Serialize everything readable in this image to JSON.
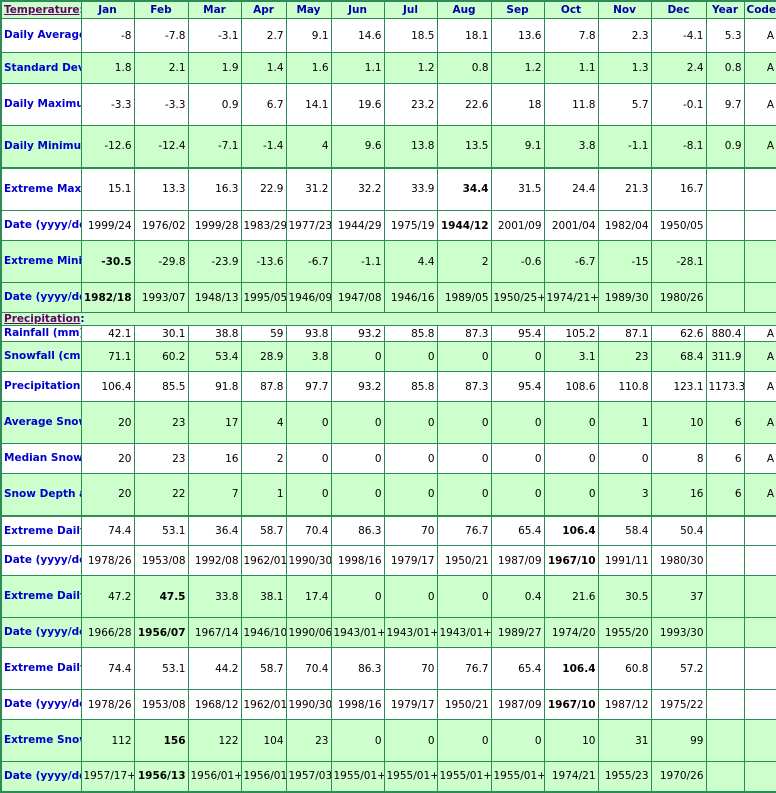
{
  "header": {
    "section_label": "Temperature",
    "months": [
      "Jan",
      "Feb",
      "Mar",
      "Apr",
      "May",
      "Jun",
      "Jul",
      "Aug",
      "Sep",
      "Oct",
      "Nov",
      "Dec"
    ],
    "year_label": "Year",
    "code_label": "Code"
  },
  "colors": {
    "border": "#2e8b57",
    "shade": "#ccffcc",
    "label_text": "#0000cc",
    "section_text": "#660066"
  },
  "temperature": [
    {
      "label": "Daily Average (°C)",
      "values": [
        "-8",
        "-7.8",
        "-3.1",
        "2.7",
        "9.1",
        "14.6",
        "18.5",
        "18.1",
        "13.6",
        "7.8",
        "2.3",
        "-4.1"
      ],
      "year": "5.3",
      "code": "A",
      "shade": false,
      "bold": []
    },
    {
      "label": "Standard Deviation",
      "values": [
        "1.8",
        "2.1",
        "1.9",
        "1.4",
        "1.6",
        "1.1",
        "1.2",
        "0.8",
        "1.2",
        "1.1",
        "1.3",
        "2.4"
      ],
      "year": "0.8",
      "code": "A",
      "shade": true,
      "bold": []
    },
    {
      "label": "Daily Maximum (°C)",
      "values": [
        "-3.3",
        "-3.3",
        "0.9",
        "6.7",
        "14.1",
        "19.6",
        "23.2",
        "22.6",
        "18",
        "11.8",
        "5.7",
        "-0.1"
      ],
      "year": "9.7",
      "code": "A",
      "shade": false,
      "bold": []
    },
    {
      "label": "Daily Minimum (°C)",
      "values": [
        "-12.6",
        "-12.4",
        "-7.1",
        "-1.4",
        "4",
        "9.6",
        "13.8",
        "13.5",
        "9.1",
        "3.8",
        "-1.1",
        "-8.1"
      ],
      "year": "0.9",
      "code": "A",
      "shade": true,
      "bold": []
    },
    {
      "label": "Extreme Maximum (°C)",
      "values": [
        "15.1",
        "13.3",
        "16.3",
        "22.9",
        "31.2",
        "32.2",
        "33.9",
        "34.4",
        "31.5",
        "24.4",
        "21.3",
        "16.7"
      ],
      "year": "",
      "code": "",
      "shade": false,
      "bold": [
        7
      ],
      "groupTop": true
    },
    {
      "label": "Date (yyyy/dd)",
      "values": [
        "1999/24",
        "1976/02",
        "1999/28",
        "1983/29",
        "1977/23",
        "1944/29",
        "1975/19",
        "1944/12",
        "2001/09",
        "2001/04",
        "1982/04",
        "1950/05"
      ],
      "year": "",
      "code": "",
      "shade": false,
      "bold": [
        7
      ]
    },
    {
      "label": "Extreme Minimum (°C)",
      "values": [
        "-30.5",
        "-29.8",
        "-23.9",
        "-13.6",
        "-6.7",
        "-1.1",
        "4.4",
        "2",
        "-0.6",
        "-6.7",
        "-15",
        "-28.1"
      ],
      "year": "",
      "code": "",
      "shade": true,
      "bold": [
        0
      ]
    },
    {
      "label": "Date (yyyy/dd)",
      "values": [
        "1982/18",
        "1993/07",
        "1948/13",
        "1995/05",
        "1946/09",
        "1947/08",
        "1946/16",
        "1989/05",
        "1950/25+",
        "1974/21+",
        "1989/30",
        "1980/26"
      ],
      "year": "",
      "code": "",
      "shade": true,
      "bold": [
        0
      ]
    }
  ],
  "precipitation_section_label": "Precipitation",
  "precipitation": [
    {
      "label": "Rainfall (mm)",
      "values": [
        "42.1",
        "30.1",
        "38.8",
        "59",
        "93.8",
        "93.2",
        "85.8",
        "87.3",
        "95.4",
        "105.2",
        "87.1",
        "62.6"
      ],
      "year": "880.4",
      "code": "A",
      "shade": false,
      "bold": []
    },
    {
      "label": "Snowfall (cm)",
      "values": [
        "71.1",
        "60.2",
        "53.4",
        "28.9",
        "3.8",
        "0",
        "0",
        "0",
        "0",
        "3.1",
        "23",
        "68.4"
      ],
      "year": "311.9",
      "code": "A",
      "shade": true,
      "bold": []
    },
    {
      "label": "Precipitation (mm)",
      "values": [
        "106.4",
        "85.5",
        "91.8",
        "87.8",
        "97.7",
        "93.2",
        "85.8",
        "87.3",
        "95.4",
        "108.6",
        "110.8",
        "123.1"
      ],
      "year": "1173.3",
      "code": "A",
      "shade": false,
      "bold": []
    },
    {
      "label": "Average Snow Depth (cm)",
      "values": [
        "20",
        "23",
        "17",
        "4",
        "0",
        "0",
        "0",
        "0",
        "0",
        "0",
        "1",
        "10"
      ],
      "year": "6",
      "code": "A",
      "shade": true,
      "bold": []
    },
    {
      "label": "Median Snow Depth (cm)",
      "values": [
        "20",
        "23",
        "16",
        "2",
        "0",
        "0",
        "0",
        "0",
        "0",
        "0",
        "0",
        "8"
      ],
      "year": "6",
      "code": "A",
      "shade": false,
      "bold": []
    },
    {
      "label": "Snow Depth at Month-end (cm)",
      "values": [
        "20",
        "22",
        "7",
        "1",
        "0",
        "0",
        "0",
        "0",
        "0",
        "0",
        "3",
        "16"
      ],
      "year": "6",
      "code": "A",
      "shade": true,
      "bold": []
    },
    {
      "label": "Extreme Daily Rainfall (mm)",
      "values": [
        "74.4",
        "53.1",
        "36.4",
        "58.7",
        "70.4",
        "86.3",
        "70",
        "76.7",
        "65.4",
        "106.4",
        "58.4",
        "50.4"
      ],
      "year": "",
      "code": "",
      "shade": false,
      "bold": [
        9
      ],
      "groupTop": true
    },
    {
      "label": "Date (yyyy/dd)",
      "values": [
        "1978/26",
        "1953/08",
        "1992/08",
        "1962/01",
        "1990/30",
        "1998/16",
        "1979/17",
        "1950/21",
        "1987/09",
        "1967/10",
        "1991/11",
        "1980/30"
      ],
      "year": "",
      "code": "",
      "shade": false,
      "bold": [
        9
      ]
    },
    {
      "label": "Extreme Daily Snowfall (cm)",
      "values": [
        "47.2",
        "47.5",
        "33.8",
        "38.1",
        "17.4",
        "0",
        "0",
        "0",
        "0.4",
        "21.6",
        "30.5",
        "37"
      ],
      "year": "",
      "code": "",
      "shade": true,
      "bold": [
        1
      ]
    },
    {
      "label": "Date (yyyy/dd)",
      "values": [
        "1966/28",
        "1956/07",
        "1967/14",
        "1946/10",
        "1990/06",
        "1943/01+",
        "1943/01+",
        "1943/01+",
        "1989/27",
        "1974/20",
        "1955/20",
        "1993/30"
      ],
      "year": "",
      "code": "",
      "shade": true,
      "bold": [
        1
      ]
    },
    {
      "label": "Extreme Daily Precipitation (mm)",
      "values": [
        "74.4",
        "53.1",
        "44.2",
        "58.7",
        "70.4",
        "86.3",
        "70",
        "76.7",
        "65.4",
        "106.4",
        "60.8",
        "57.2"
      ],
      "year": "",
      "code": "",
      "shade": false,
      "bold": [
        9
      ]
    },
    {
      "label": "Date (yyyy/dd)",
      "values": [
        "1978/26",
        "1953/08",
        "1968/12",
        "1962/01",
        "1990/30",
        "1998/16",
        "1979/17",
        "1950/21",
        "1987/09",
        "1967/10",
        "1987/12",
        "1975/22"
      ],
      "year": "",
      "code": "",
      "shade": false,
      "bold": [
        9
      ]
    },
    {
      "label": "Extreme Snow Depth (cm)",
      "values": [
        "112",
        "156",
        "122",
        "104",
        "23",
        "0",
        "0",
        "0",
        "0",
        "10",
        "31",
        "99"
      ],
      "year": "",
      "code": "",
      "shade": true,
      "bold": [
        1
      ]
    },
    {
      "label": "Date (yyyy/dd)",
      "values": [
        "1957/17+",
        "1956/13",
        "1956/01+",
        "1956/01",
        "1957/03",
        "1955/01+",
        "1955/01+",
        "1955/01+",
        "1955/01+",
        "1974/21",
        "1955/23",
        "1970/26"
      ],
      "year": "",
      "code": "",
      "shade": true,
      "bold": [
        1
      ]
    }
  ]
}
